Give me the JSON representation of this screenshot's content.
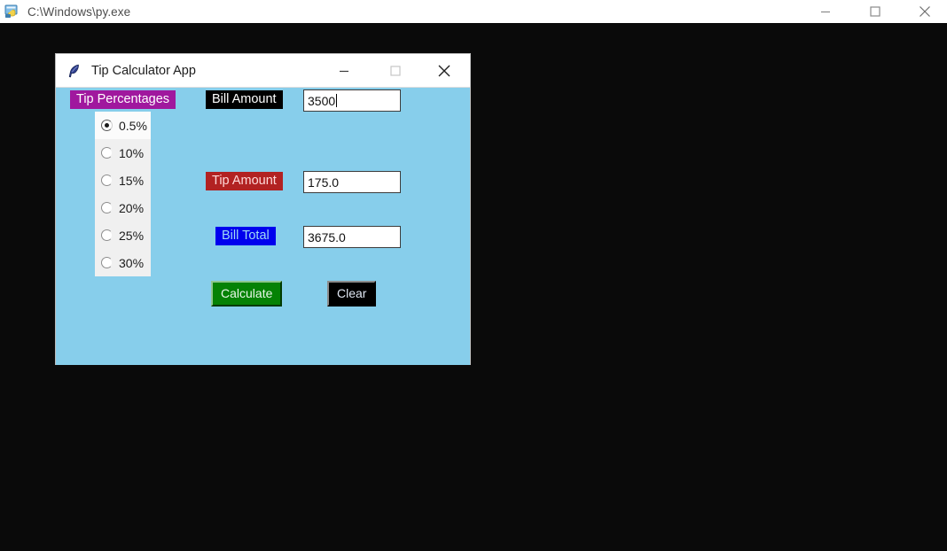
{
  "os_window": {
    "title": "C:\\Windows\\py.exe",
    "icon": "console-python-icon",
    "controls": {
      "minimize": "minimize-icon",
      "maximize": "maximize-icon",
      "close": "close-icon"
    },
    "background_color": "#0a0a0a",
    "titlebar_color": "#ffffff"
  },
  "app_window": {
    "title": "Tip Calculator App",
    "icon": "tkinter-feather-icon",
    "controls": {
      "minimize": "minimize-icon",
      "maximize": "maximize-icon",
      "close": "close-icon"
    },
    "background_color": "#87ceeb"
  },
  "tip_percentages": {
    "group_label": "Tip Percentages",
    "group_label_bg": "#a0189e",
    "group_label_fg": "#ffffff",
    "selected_value": "0.5%",
    "options": [
      {
        "label": "0.5%",
        "selected": true
      },
      {
        "label": "10%",
        "selected": false
      },
      {
        "label": "15%",
        "selected": false
      },
      {
        "label": "20%",
        "selected": false
      },
      {
        "label": "25%",
        "selected": false
      },
      {
        "label": "30%",
        "selected": false
      }
    ]
  },
  "fields": {
    "bill_amount": {
      "label": "Bill Amount",
      "label_bg": "#000000",
      "label_fg": "#ffffff",
      "value": "3500",
      "focused": true
    },
    "tip_amount": {
      "label": "Tip  Amount",
      "label_bg": "#b22222",
      "label_fg": "#ffd9d9",
      "value": "175.0",
      "focused": false
    },
    "bill_total": {
      "label": "Bill Total",
      "label_bg": "#0000ee",
      "label_fg": "#9fd9f5",
      "value": "3675.0",
      "focused": false
    }
  },
  "buttons": {
    "calculate": {
      "label": "Calculate",
      "bg": "#058205",
      "fg": "#eaf7ea"
    },
    "clear": {
      "label": "Clear",
      "bg": "#000000",
      "fg": "#dfe6f2"
    }
  }
}
